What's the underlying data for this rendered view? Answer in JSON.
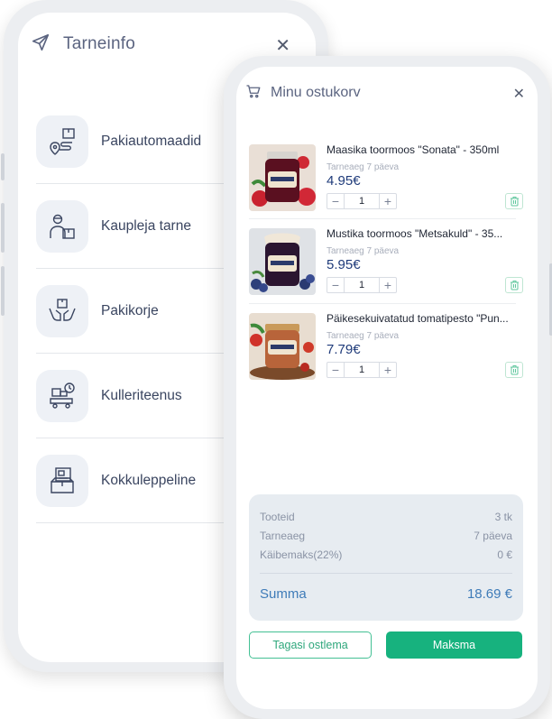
{
  "delivery": {
    "title": "Tarneinfo",
    "close_icon": "close-icon",
    "options": [
      {
        "label": "Pakiautomaadid",
        "icon": "parcel-locker-route-icon"
      },
      {
        "label": "Kaupleja tarne",
        "icon": "courier-person-icon"
      },
      {
        "label": "Pakikorje",
        "icon": "hands-package-icon"
      },
      {
        "label": "Kulleriteenus",
        "icon": "delivery-truck-clock-icon"
      },
      {
        "label": "Kokkuleppeline",
        "icon": "document-box-icon"
      }
    ]
  },
  "cart": {
    "title": "Minu ostukorv",
    "items": [
      {
        "name": "Maasika toormoos \"Sonata\" - 350ml",
        "delivery": "Tarneaeg 7 päeva",
        "price": "4.95€",
        "qty": "1",
        "image": "strawberry-jam-jar"
      },
      {
        "name": "Mustika toormoos \"Metsakuld\" - 35...",
        "delivery": "Tarneaeg 7 päeva",
        "price": "5.95€",
        "qty": "1",
        "image": "blueberry-jam-jar"
      },
      {
        "name": "Päikesekuivatatud tomatipesto \"Pun...",
        "delivery": "Tarneaeg 7 päeva",
        "price": "7.79€",
        "qty": "1",
        "image": "tomato-pesto-jar"
      }
    ],
    "summary": {
      "products_label": "Tooteid",
      "products_value": "3 tk",
      "delivery_label": "Tarneaeg",
      "delivery_value": "7 päeva",
      "vat_label": "Käibemaks(22%)",
      "vat_value": "0 €",
      "total_label": "Summa",
      "total_value": "18.69 €"
    },
    "back_button": "Tagasi ostlema",
    "pay_button": "Maksma"
  },
  "colors": {
    "accent_green": "#17b27e",
    "price_blue": "#1f3b7a",
    "total_blue": "#3e7bb8"
  }
}
